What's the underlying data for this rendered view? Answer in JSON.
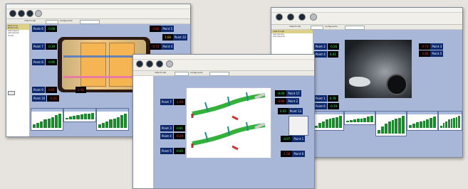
{
  "menu": [
    "File",
    "View",
    "Tools",
    "Help"
  ],
  "toolbar": {
    "btn1": "Measure",
    "btn2": "Compare",
    "btn3": "Reference"
  },
  "options": {
    "label1": "Vista Frontal",
    "label2": "Configuración"
  },
  "win1": {
    "sidebar_head": "Seleccione Mediciones",
    "sidebar_lines": [
      "Vista Superior",
      "Lado Derecho",
      "Frontal",
      "Trasera"
    ],
    "points": [
      {
        "label": "Point 6",
        "value": "-0.08",
        "color": "green"
      },
      {
        "label": "Point 7",
        "value": "-0.39",
        "color": "green"
      },
      {
        "label": "Point 8",
        "value": "-0.06",
        "color": "green"
      },
      {
        "label": "Point 9",
        "value": "-0.01",
        "color": "red"
      },
      {
        "label": "Point 10",
        "value": "-0.03",
        "color": "red"
      },
      {
        "label": "Point 5",
        "value": "-3.82",
        "color": "red"
      },
      {
        "label": "Point 4",
        "value": "-0.72",
        "color": "red"
      },
      {
        "label": "Point 22",
        "value": "3.68",
        "color": "yellow"
      },
      {
        "label": "",
        "value": "0.02",
        "color": "red"
      }
    ]
  },
  "win2": {
    "points": [
      {
        "label": "Point 7",
        "value": "-1.49",
        "color": "red"
      },
      {
        "label": "Point 3",
        "value": "-0.81",
        "color": "green"
      },
      {
        "label": "Point 4",
        "value": "-0.29",
        "color": "red"
      },
      {
        "label": "Point 5",
        "value": "-0.05",
        "color": "green"
      },
      {
        "label": "Point 17",
        "value": "-0.00",
        "color": "green"
      },
      {
        "label": "Point 2",
        "value": "-0.86",
        "color": "red"
      },
      {
        "label": "Point 1",
        "value": "-0.97",
        "color": "green"
      },
      {
        "label": "Point 6",
        "value": "-1.58",
        "color": "red"
      },
      {
        "label": "Point 13",
        "value": "0.05",
        "color": "green"
      }
    ]
  },
  "win3": {
    "sidebar_head": "Vista Frontal",
    "sidebar_lines": [
      "Lado Derecho",
      "Lado Izquierdo"
    ],
    "points": [
      {
        "label": "Point 2",
        "value": "-0.26",
        "color": "green"
      },
      {
        "label": "Point 4",
        "value": "0.03",
        "color": "green"
      },
      {
        "label": "Point 3",
        "value": "-0.74",
        "color": "red"
      },
      {
        "label": "Point 5",
        "value": "-2.40",
        "color": "red"
      },
      {
        "label": "Point 1",
        "value": "0.78",
        "color": "green"
      },
      {
        "label": "Point 6",
        "value": "-0.19",
        "color": "green"
      }
    ]
  },
  "charts": {
    "series_a": [
      0.25,
      0.35,
      0.45,
      0.55,
      0.6,
      0.7,
      0.85,
      0.95
    ],
    "series_b": [
      0.2,
      0.4,
      0.55,
      0.7,
      0.75,
      0.85,
      0.9,
      1.0
    ]
  }
}
